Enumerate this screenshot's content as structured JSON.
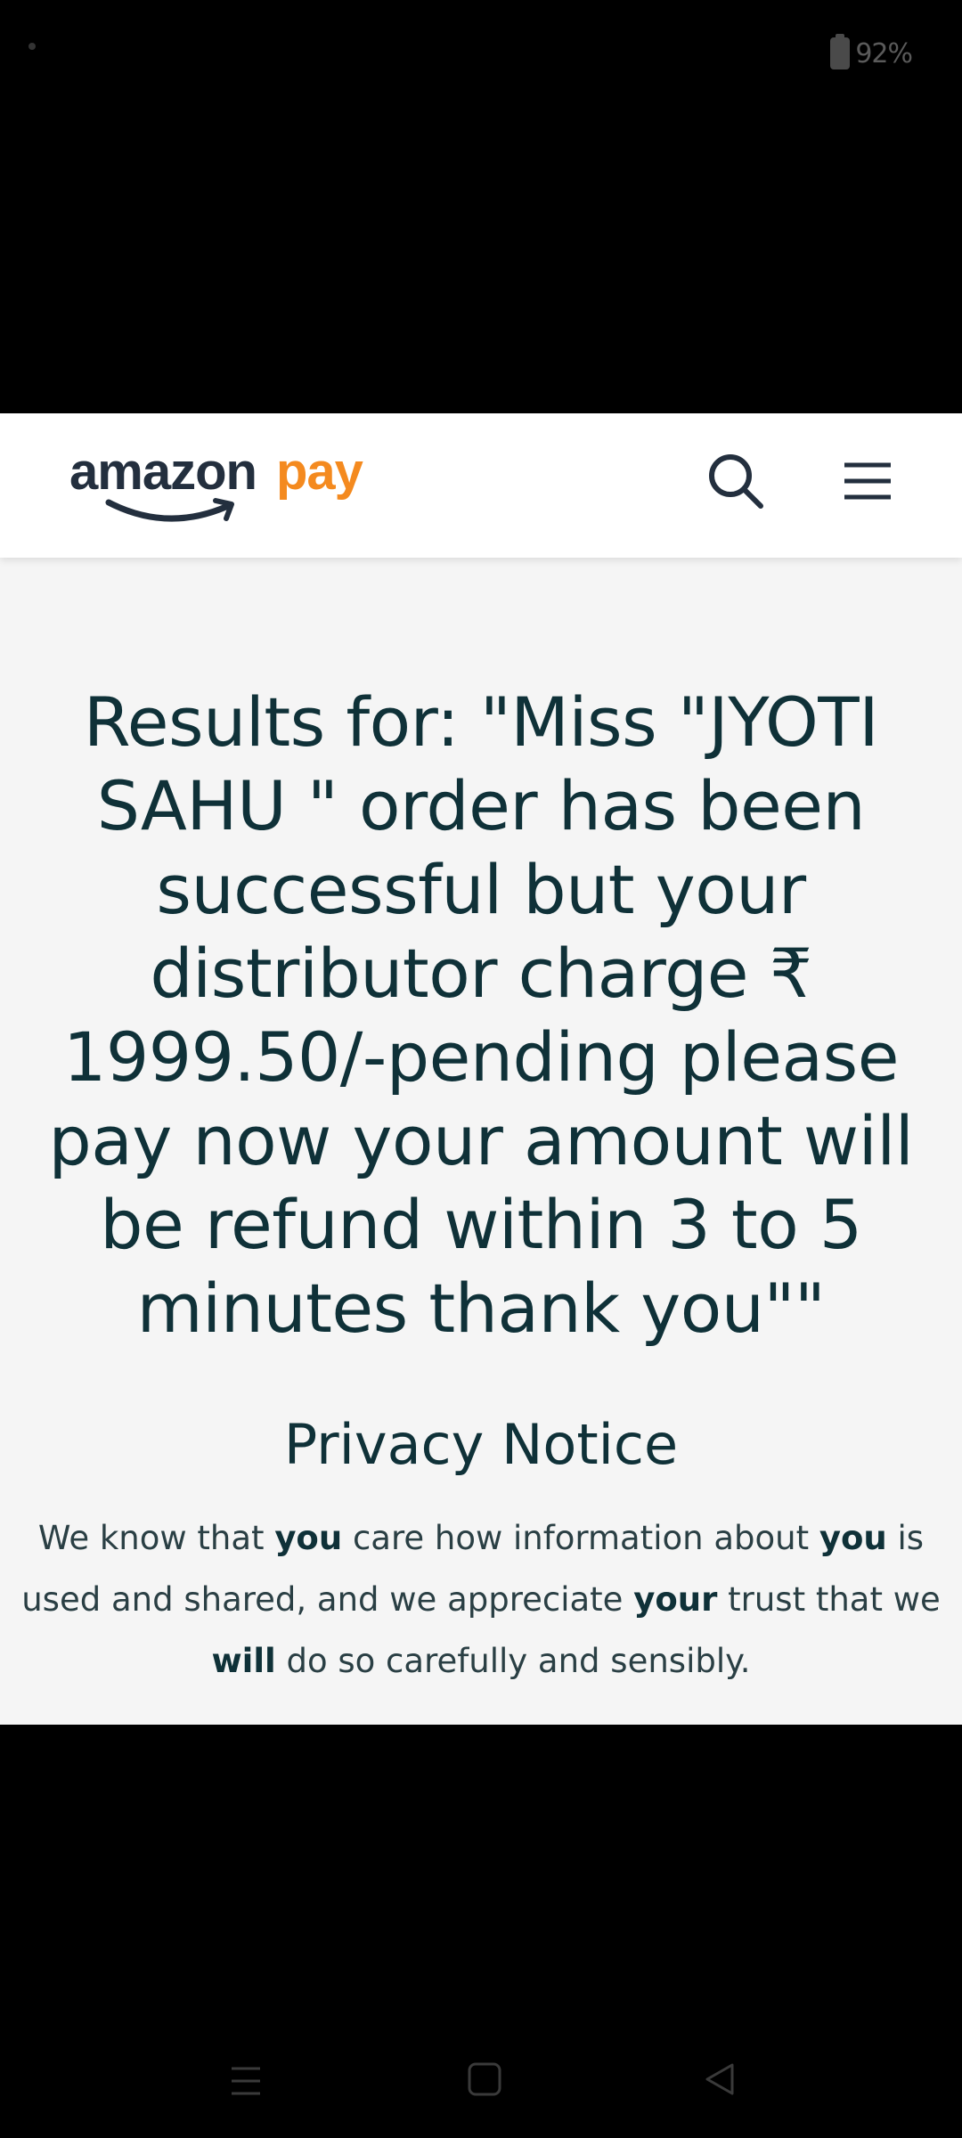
{
  "status_bar": {
    "battery_text": "92%",
    "battery_icon": "battery-icon"
  },
  "header": {
    "logo": {
      "word1": "amazon",
      "word2": "pay",
      "brand_color_dark": "#232f3e",
      "brand_color_orange": "#f48a1f"
    },
    "search_icon": "search-icon",
    "menu_icon": "hamburger-menu-icon"
  },
  "main": {
    "results_title": "Results for: \"Miss \"JYOTI SAHU \" order has been successful but your distributor charge ₹ 1999.50/-pending please pay now your amount will be refund within 3 to 5 minutes thank you\"\"",
    "privacy_heading": "Privacy Notice",
    "privacy_text": {
      "s1": "We know that ",
      "b1": "you",
      "s2": " care how information about ",
      "b2": "you",
      "s3": " is used and shared, and we appreciate ",
      "b3": "your",
      "s4": " trust that we ",
      "b4": "will",
      "s5": " do so carefully and sensibly."
    }
  },
  "nav_bar": {
    "recents_icon": "recents-icon",
    "home_icon": "home-icon",
    "back_icon": "back-icon"
  },
  "colors": {
    "page_background": "#f5f5f5",
    "header_background": "#ffffff",
    "text_dark_teal": "#0f3138",
    "frame_black": "#000000"
  }
}
